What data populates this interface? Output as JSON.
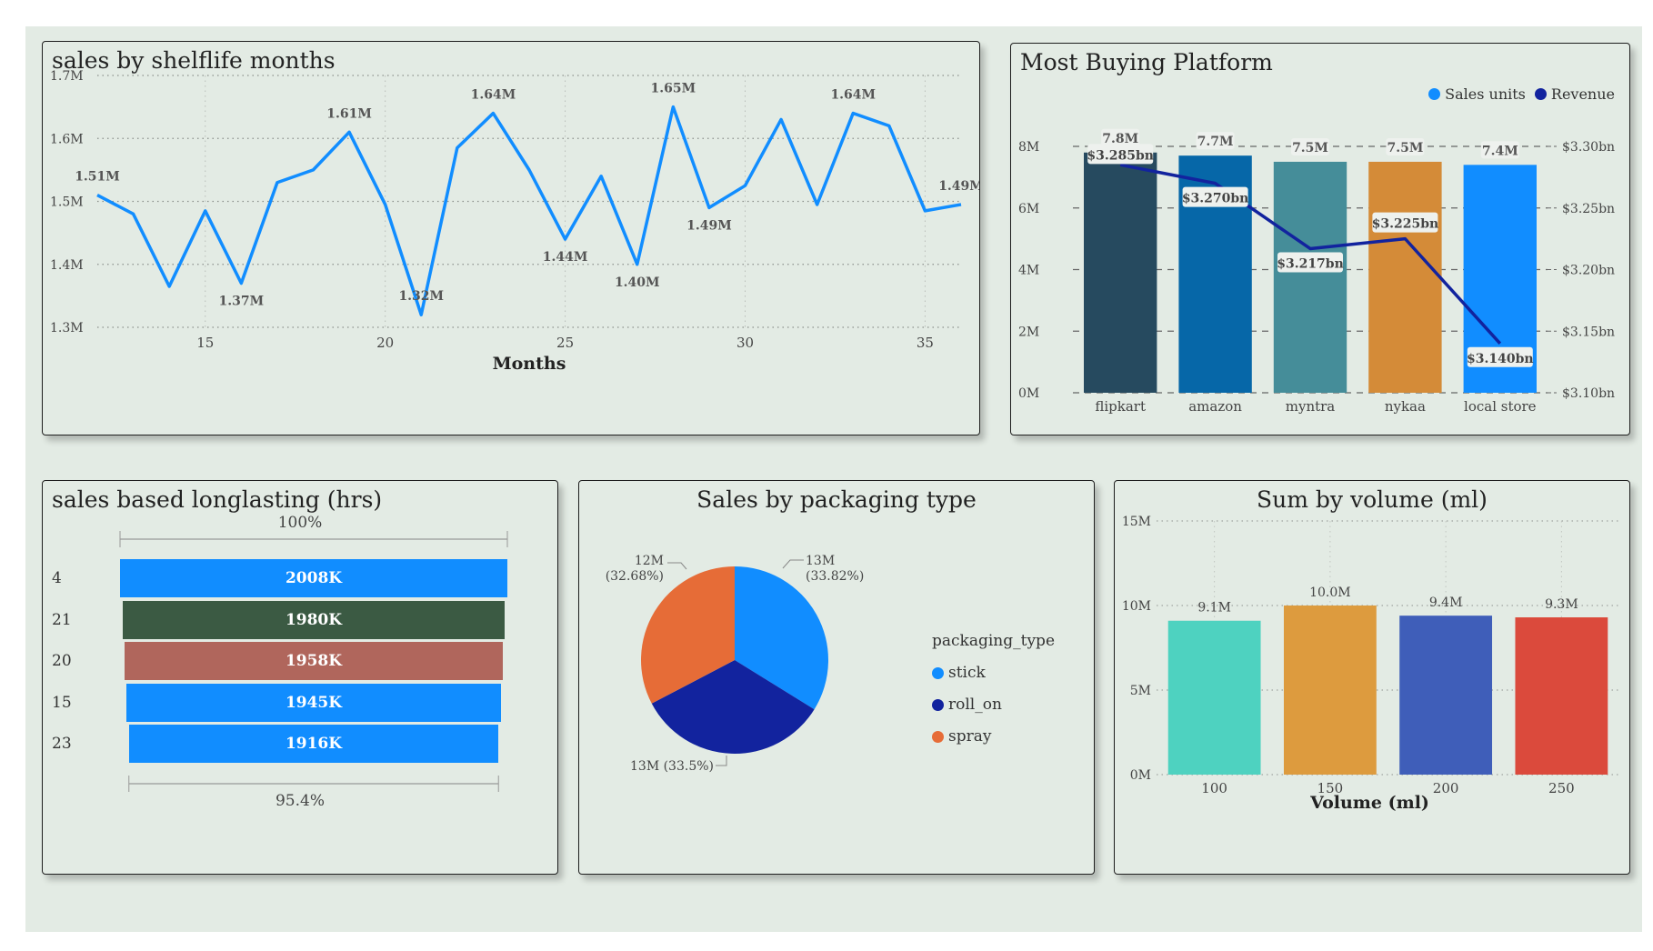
{
  "colors": {
    "background": "#e3ebe4",
    "blue": "#118dff",
    "navy": "#12239e"
  },
  "chart_data": [
    {
      "id": "shelflife",
      "type": "line",
      "title": "sales by shelflife months",
      "xlabel": "Months",
      "ylabel": "",
      "xlim": [
        12,
        36
      ],
      "ylim": [
        1.3,
        1.7
      ],
      "xticks": [
        "15",
        "20",
        "25",
        "30",
        "35"
      ],
      "yticks": [
        "1.3M",
        "1.4M",
        "1.5M",
        "1.6M",
        "1.7M"
      ],
      "grid": true,
      "color": "#118dff",
      "x": [
        12,
        13,
        14,
        15,
        16,
        17,
        18,
        19,
        20,
        21,
        22,
        23,
        24,
        25,
        26,
        27,
        28,
        29,
        30,
        31,
        32,
        33,
        34,
        35,
        36
      ],
      "y": [
        1.51,
        1.48,
        1.365,
        1.485,
        1.37,
        1.53,
        1.55,
        1.61,
        1.495,
        1.32,
        1.585,
        1.64,
        1.55,
        1.44,
        1.54,
        1.4,
        1.65,
        1.49,
        1.525,
        1.63,
        1.495,
        1.64,
        1.62,
        1.485,
        1.495
      ],
      "data_labels": [
        {
          "x": 12,
          "y": 1.51,
          "text": "1.51M",
          "pos": "above"
        },
        {
          "x": 16,
          "y": 1.37,
          "text": "1.37M",
          "pos": "below"
        },
        {
          "x": 19,
          "y": 1.61,
          "text": "1.61M",
          "pos": "above"
        },
        {
          "x": 21,
          "y": 1.32,
          "text": "1.32M",
          "pos": "above"
        },
        {
          "x": 23,
          "y": 1.64,
          "text": "1.64M",
          "pos": "above"
        },
        {
          "x": 25,
          "y": 1.44,
          "text": "1.44M",
          "pos": "below"
        },
        {
          "x": 27,
          "y": 1.4,
          "text": "1.40M",
          "pos": "below"
        },
        {
          "x": 28,
          "y": 1.65,
          "text": "1.65M",
          "pos": "above"
        },
        {
          "x": 29,
          "y": 1.49,
          "text": "1.49M",
          "pos": "below"
        },
        {
          "x": 33,
          "y": 1.64,
          "text": "1.64M",
          "pos": "above"
        },
        {
          "x": 36,
          "y": 1.495,
          "text": "1.49M",
          "pos": "above"
        }
      ]
    },
    {
      "id": "platform",
      "type": "bar",
      "title": "Most Buying Platform",
      "categories": [
        "flipkart",
        "amazon",
        "myntra",
        "nykaa",
        "local store"
      ],
      "bar_colors": [
        "#264a5f",
        "#0667a8",
        "#458d99",
        "#d48b38",
        "#118dff"
      ],
      "series": [
        {
          "name": "Sales units",
          "type": "bar",
          "color": "#118dff",
          "values": [
            7.8,
            7.7,
            7.5,
            7.5,
            7.4
          ],
          "labels": [
            "7.8M",
            "7.7M",
            "7.5M",
            "7.5M",
            "7.4M"
          ]
        },
        {
          "name": "Revenue",
          "type": "line",
          "color": "#12239e",
          "values": [
            3.285,
            3.27,
            3.217,
            3.225,
            3.14
          ],
          "labels": [
            "$3.285bn",
            "$3.270bn",
            "$3.217bn",
            "$3.225bn",
            "$3.140bn"
          ]
        }
      ],
      "ylim": [
        0,
        8
      ],
      "yticks": [
        "0M",
        "2M",
        "4M",
        "6M",
        "8M"
      ],
      "y2lim": [
        3.1,
        3.3
      ],
      "y2ticks": [
        "$3.10bn",
        "$3.15bn",
        "$3.20bn",
        "$3.25bn",
        "$3.30bn"
      ],
      "grid": true,
      "legend": "top-right"
    },
    {
      "id": "longlasting",
      "type": "bar",
      "orientation": "horizontal",
      "title": "sales based longlasting (hrs)",
      "categories": [
        "4",
        "21",
        "20",
        "15",
        "23"
      ],
      "values": [
        2008,
        1980,
        1958,
        1945,
        1916
      ],
      "labels": [
        "2008K",
        "1980K",
        "1958K",
        "1945K",
        "1916K"
      ],
      "bar_colors": [
        "#118dff",
        "#3b5a43",
        "#b0665c",
        "#118dff",
        "#118dff"
      ],
      "top_percent": "100%",
      "bottom_percent": "95.4%"
    },
    {
      "id": "packaging",
      "type": "pie",
      "title": "Sales by packaging type",
      "legend_title": "packaging_type",
      "legend": "right",
      "slices": [
        {
          "name": "stick",
          "value": 33.82,
          "color": "#118dff",
          "label_a": "13M",
          "label_b": "(33.82%)"
        },
        {
          "name": "roll_on",
          "value": 33.5,
          "color": "#12239e",
          "label_a": "13M (33.5%)",
          "label_b": ""
        },
        {
          "name": "spray",
          "value": 32.68,
          "color": "#e66c37",
          "label_a": "12M",
          "label_b": "(32.68%)"
        }
      ]
    },
    {
      "id": "volume",
      "type": "bar",
      "title": "Sum by volume (ml)",
      "xlabel": "Volume (ml)",
      "ylabel": "",
      "categories": [
        "100",
        "150",
        "200",
        "250"
      ],
      "values": [
        9.1,
        10.0,
        9.4,
        9.3
      ],
      "labels": [
        "9.1M",
        "10.0M",
        "9.4M",
        "9.3M"
      ],
      "bar_colors": [
        "#4ed2c0",
        "#dd9b3e",
        "#3f5eb9",
        "#db4a3c"
      ],
      "ylim": [
        0,
        15
      ],
      "yticks": [
        "0M",
        "5M",
        "10M",
        "15M"
      ],
      "grid": true
    }
  ]
}
